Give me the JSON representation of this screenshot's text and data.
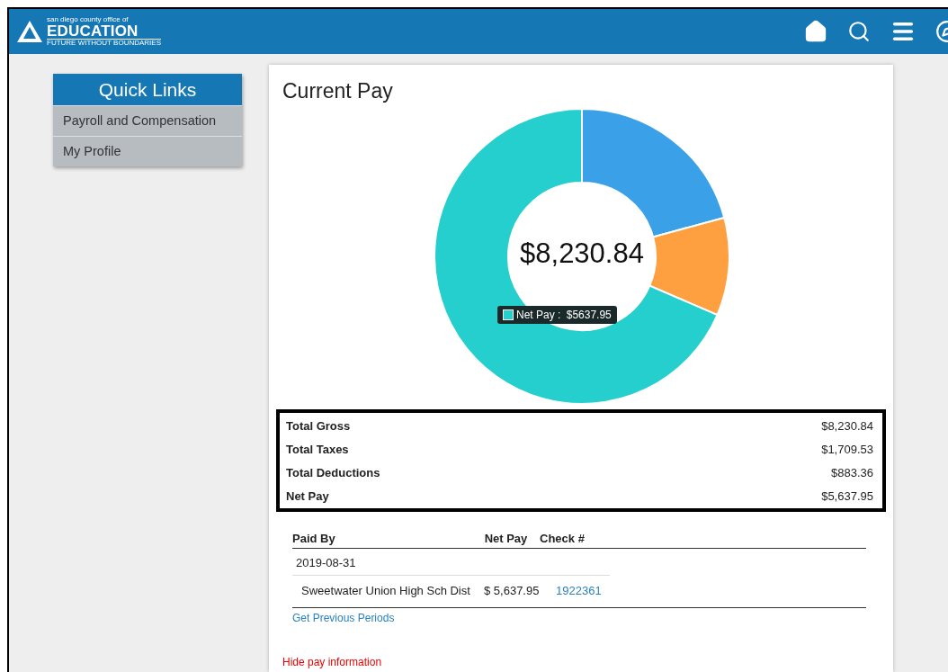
{
  "header": {
    "logo": {
      "tagline_top": "san diego county office of",
      "name": "EDUCATION",
      "tagline_bottom": "FUTURE WITHOUT BOUNDARIES"
    }
  },
  "quick_links": {
    "title": "Quick Links",
    "items": [
      {
        "label": "Payroll and Compensation"
      },
      {
        "label": "My Profile"
      }
    ]
  },
  "current_pay": {
    "title": "Current Pay",
    "center_label": "$8,230.84",
    "chart_data": {
      "type": "donut",
      "values": [
        20.77,
        10.73,
        68.5
      ],
      "colors": [
        "#3aa0e8",
        "#ffa040",
        "#24cfce"
      ]
    },
    "tooltip": {
      "label": "Net Pay :",
      "value": "$5637.95",
      "color": "#24cfce"
    },
    "summary": [
      {
        "label": "Total Gross",
        "value": "$8,230.84"
      },
      {
        "label": "Total Taxes",
        "value": "$1,709.53"
      },
      {
        "label": "Total Deductions",
        "value": "$883.36"
      },
      {
        "label": "Net Pay",
        "value": "$5,637.95"
      }
    ],
    "payments": {
      "columns": [
        "Paid By",
        "Net Pay",
        "Check #"
      ],
      "date": "2019-08-31",
      "rows": [
        {
          "paid_by": "Sweetwater Union High Sch Dist",
          "net_pay": "$ 5,637.95",
          "check": "1922361"
        }
      ]
    },
    "previous_link": "Get Previous Periods",
    "hide_link": "Hide pay information"
  }
}
